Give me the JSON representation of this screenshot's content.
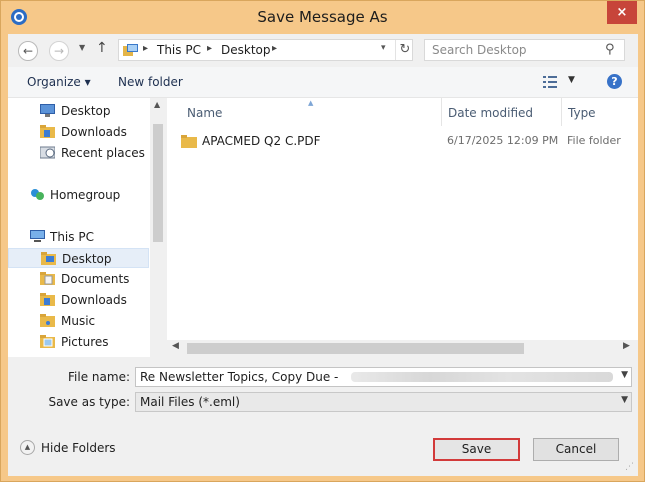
{
  "window": {
    "title": "Save Message As",
    "close_label": "×",
    "accent_border": "#f6c889",
    "close_color": "#c7453a"
  },
  "address": {
    "back_icon": "back-arrow-icon",
    "forward_icon": "forward-arrow-icon",
    "up_icon": "up-arrow-icon",
    "crumbs": [
      "This PC",
      "Desktop"
    ],
    "refresh_icon": "refresh-icon"
  },
  "search": {
    "placeholder": "Search Desktop"
  },
  "toolbar": {
    "organize_label": "Organize ▾",
    "new_folder_label": "New folder"
  },
  "nav": {
    "items": [
      {
        "label": "Desktop",
        "icon": "desktop-icon"
      },
      {
        "label": "Downloads",
        "icon": "downloads-folder-icon"
      },
      {
        "label": "Recent places",
        "icon": "recent-places-icon"
      },
      {
        "label": "Homegroup",
        "icon": "homegroup-icon"
      },
      {
        "label": "This PC",
        "icon": "computer-icon"
      },
      {
        "label": "Desktop",
        "icon": "desktop-folder-icon",
        "selected": true
      },
      {
        "label": "Documents",
        "icon": "documents-folder-icon"
      },
      {
        "label": "Downloads",
        "icon": "downloads-folder-icon"
      },
      {
        "label": "Music",
        "icon": "music-folder-icon"
      },
      {
        "label": "Pictures",
        "icon": "pictures-folder-icon"
      }
    ]
  },
  "columns": {
    "name": "Name",
    "date_modified": "Date modified",
    "type": "Type"
  },
  "files": [
    {
      "name": "APACMED Q2 C.PDF",
      "date": "6/17/2025 12:09 PM",
      "type": "File folder"
    }
  ],
  "form": {
    "file_name_label": "File name:",
    "file_name_value": "Re  Newsletter Topics, Copy Due -",
    "save_as_type_label": "Save as type:",
    "save_as_type_value": "Mail Files (*.eml)"
  },
  "footer": {
    "hide_folders_label": "Hide Folders",
    "save_label": "Save",
    "cancel_label": "Cancel"
  }
}
